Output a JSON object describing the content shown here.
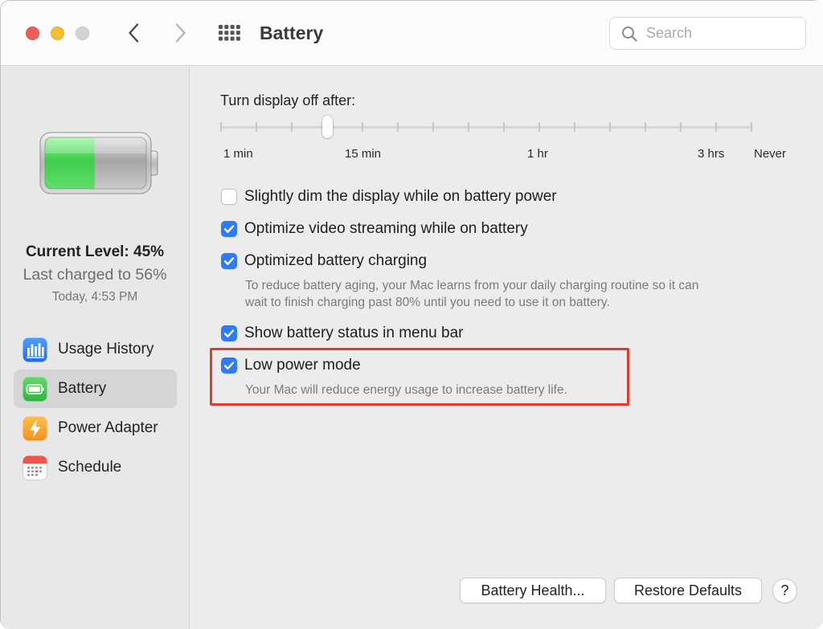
{
  "window": {
    "title": "Battery"
  },
  "toolbar": {
    "back_icon": "chevron-left-icon",
    "forward_icon": "chevron-right-icon",
    "show_all_icon": "grid-icon",
    "search": {
      "placeholder": "Search",
      "icon": "search-icon"
    }
  },
  "sidebar": {
    "battery_status": {
      "icon": "battery-level-icon",
      "fill_fraction": 0.49,
      "current_level": "Current Level: 45%",
      "last_charged": "Last charged to 56%",
      "timestamp": "Today, 4:53 PM"
    },
    "items": [
      {
        "label": "Usage History",
        "icon": "usage-history-icon",
        "selected": false
      },
      {
        "label": "Battery",
        "icon": "battery-icon",
        "selected": true
      },
      {
        "label": "Power Adapter",
        "icon": "power-adapter-icon",
        "selected": false
      },
      {
        "label": "Schedule",
        "icon": "schedule-icon",
        "selected": false
      }
    ]
  },
  "main": {
    "display_off": {
      "label": "Turn display off after:",
      "slider_value_fraction": 0.2,
      "tick_labels": [
        "1 min",
        "15 min",
        "1 hr",
        "3 hrs",
        "Never"
      ]
    },
    "options": [
      {
        "label": "Slightly dim the display while on battery power",
        "checked": false
      },
      {
        "label": "Optimize video streaming while on battery",
        "checked": true
      },
      {
        "label": "Optimized battery charging",
        "checked": true,
        "description_lines": [
          "To reduce battery aging, your Mac learns from your daily charging routine so it can",
          "wait to finish charging past 80% until you need to use it on battery."
        ]
      },
      {
        "label": "Show battery status in menu bar",
        "checked": true
      },
      {
        "label": "Low power mode",
        "checked": true,
        "highlighted": true,
        "description_lines": [
          "Your Mac will reduce energy usage to increase battery life."
        ]
      }
    ]
  },
  "footer": {
    "battery_health_label": "Battery Health...",
    "restore_defaults_label": "Restore Defaults",
    "help_label": "?"
  },
  "colors": {
    "accent": "#2f7bf5",
    "highlight": "#e5392d",
    "traffic_close": "#ee5e57",
    "traffic_minimize": "#f5bd30",
    "traffic_zoom": "#d3d3d3"
  }
}
